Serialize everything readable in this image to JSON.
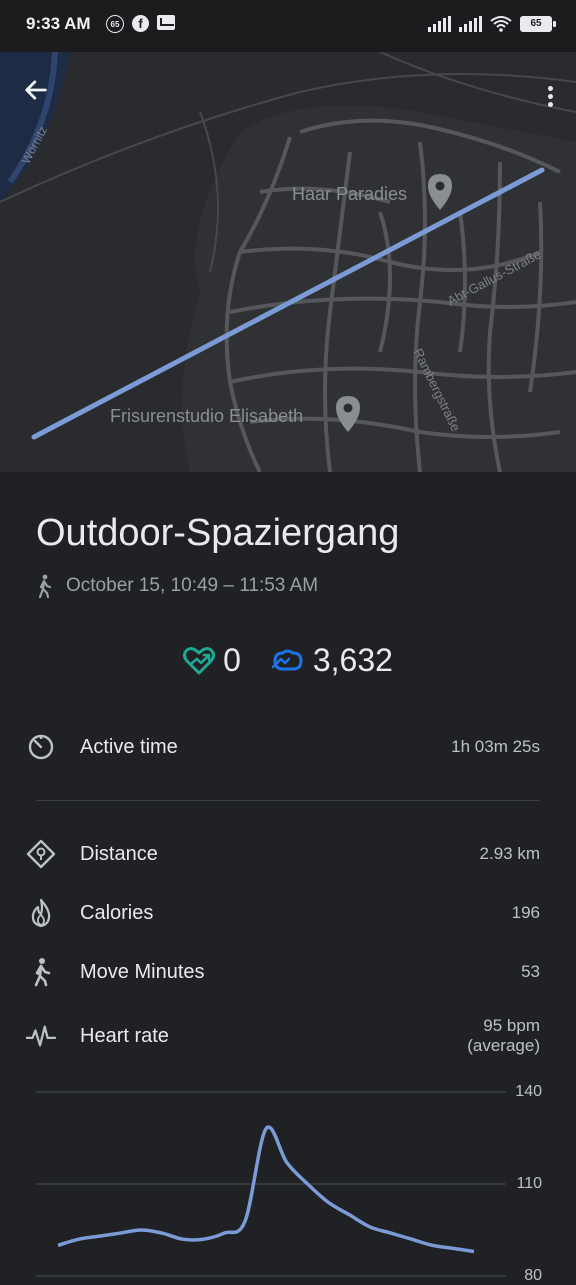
{
  "status_bar": {
    "time": "9:33 AM",
    "badge_number": "65",
    "fb_letter": "f",
    "battery": "65"
  },
  "map": {
    "labels": {
      "river": "Wörnitz",
      "poi_1": "Haar Paradies",
      "poi_2": "Frisurenstudio Elisabeth",
      "street_1": "Abt-Gallus-Straße",
      "street_2": "Rambergstraße"
    },
    "colors": {
      "route": "#7b9bd6",
      "road": "#55575c",
      "water": "#1e2b44"
    }
  },
  "activity": {
    "title": "Outdoor-Spaziergang",
    "date_range": "October 15, 10:49 – 11:53 AM",
    "heart_points": "0",
    "steps": "3,632"
  },
  "stats": {
    "active_time": {
      "label": "Active time",
      "value": "1h 03m 25s"
    },
    "distance": {
      "label": "Distance",
      "value": "2.93 km"
    },
    "calories": {
      "label": "Calories",
      "value": "196"
    },
    "move_minutes": {
      "label": "Move Minutes",
      "value": "53"
    },
    "heart_rate": {
      "label": "Heart rate",
      "value": "95 bpm",
      "sub": "(average)"
    }
  },
  "chart_data": {
    "type": "line",
    "title": "",
    "xlabel": "",
    "ylabel": "",
    "y_ticks": [
      "140",
      "110",
      "80"
    ],
    "ylim": [
      80,
      140
    ],
    "series": [
      {
        "color": "#7b9bd6",
        "x": [
          0,
          1,
          2,
          3,
          4,
          5,
          6,
          7,
          8,
          9,
          10,
          11,
          12,
          13,
          14,
          15,
          16,
          17,
          18,
          19,
          20
        ],
        "y": [
          90,
          92,
          93,
          94,
          95,
          94,
          92,
          92,
          94,
          98,
          128,
          117,
          110,
          104,
          100,
          96,
          94,
          92,
          90,
          89,
          88
        ]
      }
    ]
  }
}
